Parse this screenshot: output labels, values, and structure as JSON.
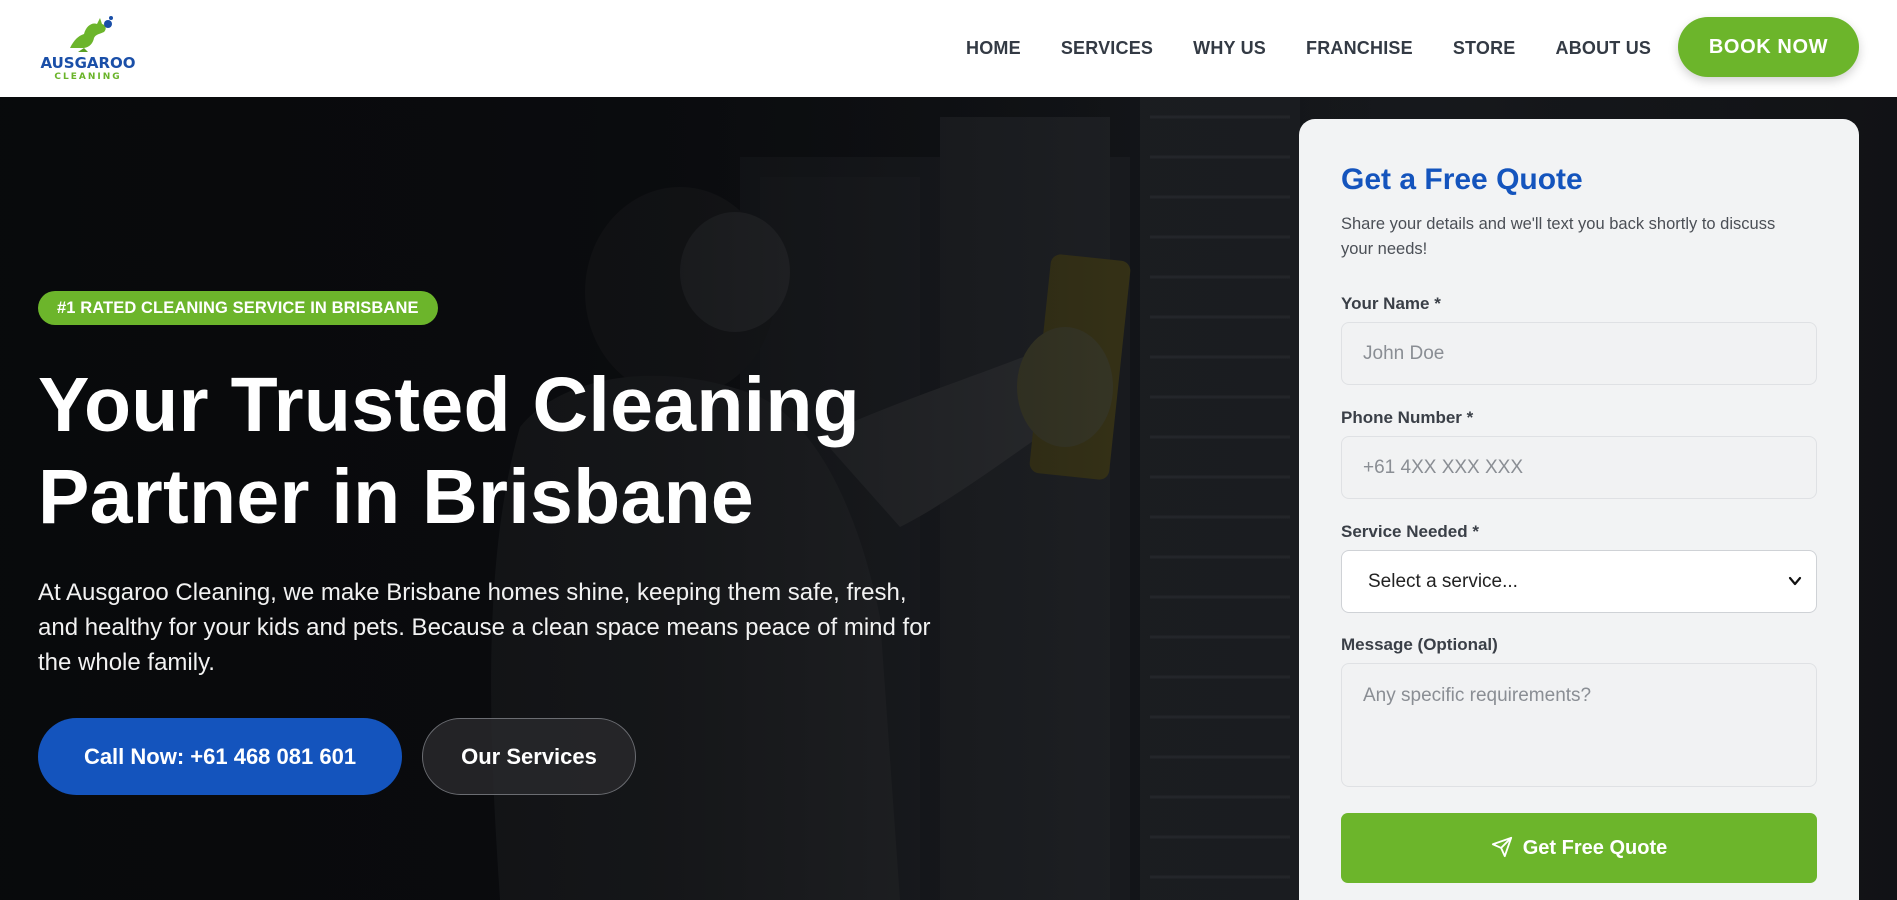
{
  "brand": {
    "name": "AUSGAROO",
    "tagline": "CLEANING",
    "logo_icon": "kangaroo-logo-icon",
    "colors": {
      "primary_blue": "#1454bd",
      "accent_green": "#6cb52b"
    }
  },
  "nav": {
    "items": [
      {
        "label": "HOME"
      },
      {
        "label": "SERVICES"
      },
      {
        "label": "WHY US"
      },
      {
        "label": "FRANCHISE"
      },
      {
        "label": "STORE"
      },
      {
        "label": "ABOUT US"
      }
    ],
    "cta_label": "BOOK NOW"
  },
  "hero": {
    "badge": "#1 RATED CLEANING SERVICE IN BRISBANE",
    "title_line1": "Your Trusted Cleaning",
    "title_line2": "Partner in Brisbane",
    "description": "At Ausgaroo Cleaning, we make Brisbane homes shine, keeping them safe, fresh, and healthy for your kids and pets. Because a clean space means peace of mind for the whole family.",
    "primary_button": "Call Now: +61 468 081 601",
    "secondary_button": "Our Services"
  },
  "quote_form": {
    "title": "Get a Free Quote",
    "subtitle": "Share your details and we'll text you back shortly to discuss your needs!",
    "name_label": "Your Name *",
    "name_placeholder": "John Doe",
    "phone_label": "Phone Number *",
    "phone_placeholder": "+61 4XX XXX XXX",
    "service_label": "Service Needed *",
    "service_selected": "Select a service...",
    "message_label": "Message (Optional)",
    "message_placeholder": "Any specific requirements?",
    "submit_label": "Get Free Quote",
    "submit_icon": "send-icon"
  }
}
